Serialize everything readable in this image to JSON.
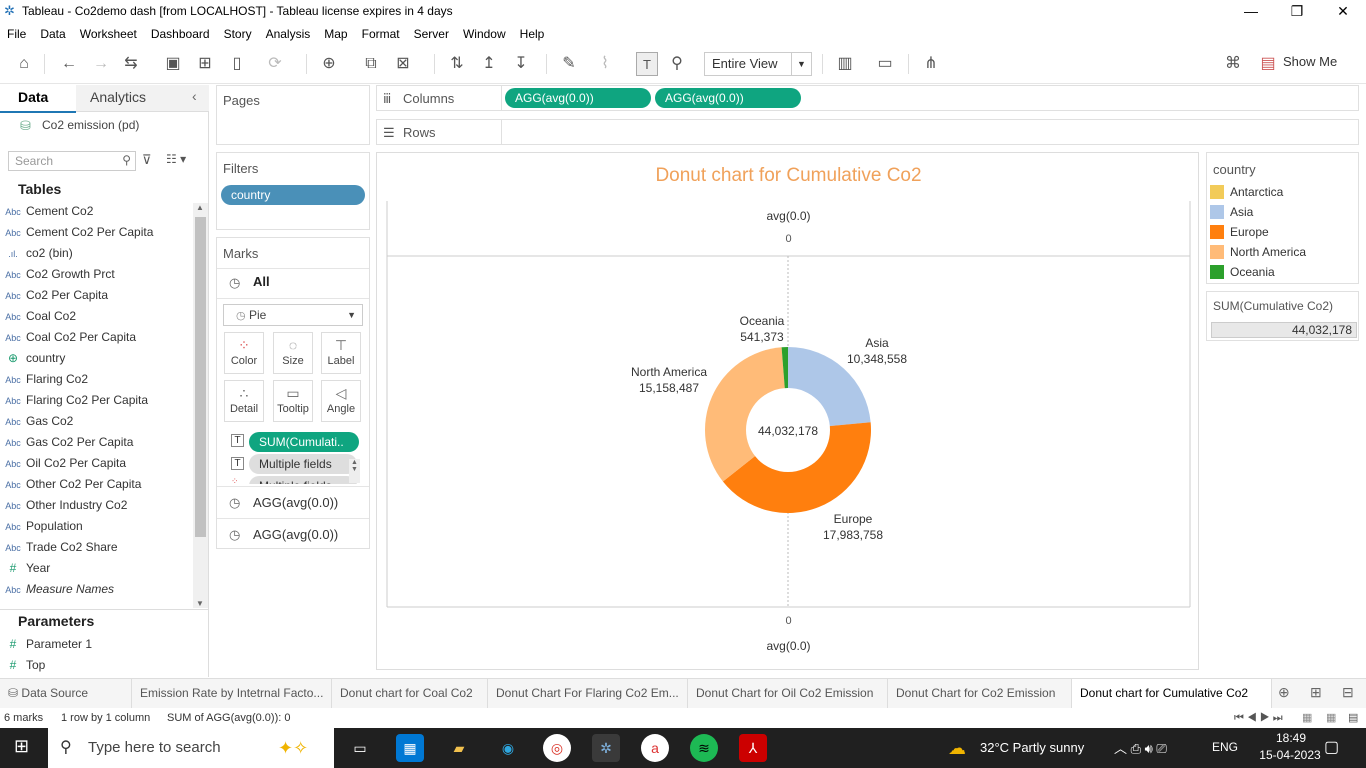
{
  "window": {
    "title": "Tableau - Co2demo dash [from LOCALHOST] - Tableau license expires in 4 days"
  },
  "menu": [
    "File",
    "Data",
    "Worksheet",
    "Dashboard",
    "Story",
    "Analysis",
    "Map",
    "Format",
    "Server",
    "Window",
    "Help"
  ],
  "toolbar": {
    "view_mode": "Entire View",
    "show_me": "Show Me"
  },
  "sidebar": {
    "tab_data": "Data",
    "tab_analytics": "Analytics",
    "datasource": "Co2 emission (pd)",
    "search_placeholder": "Search",
    "tables_heading": "Tables",
    "fields": [
      {
        "type": "Abc",
        "name": "Cement Co2"
      },
      {
        "type": "Abc",
        "name": "Cement Co2 Per Capita"
      },
      {
        "type": ".ıl.",
        "name": "co2 (bin)"
      },
      {
        "type": "Abc",
        "name": "Co2 Growth Prct"
      },
      {
        "type": "Abc",
        "name": "Co2 Per Capita"
      },
      {
        "type": "Abc",
        "name": "Coal Co2"
      },
      {
        "type": "Abc",
        "name": "Coal Co2 Per Capita"
      },
      {
        "type": "⊕",
        "name": "country"
      },
      {
        "type": "Abc",
        "name": "Flaring Co2"
      },
      {
        "type": "Abc",
        "name": "Flaring Co2 Per Capita"
      },
      {
        "type": "Abc",
        "name": "Gas Co2"
      },
      {
        "type": "Abc",
        "name": "Gas Co2 Per Capita"
      },
      {
        "type": "Abc",
        "name": "Oil Co2 Per Capita"
      },
      {
        "type": "Abc",
        "name": "Other Co2 Per Capita"
      },
      {
        "type": "Abc",
        "name": "Other Industry Co2"
      },
      {
        "type": "Abc",
        "name": "Population"
      },
      {
        "type": "Abc",
        "name": "Trade Co2 Share"
      },
      {
        "type": "#",
        "name": "Year"
      },
      {
        "type": "Abc",
        "name": "Measure Names"
      }
    ],
    "parameters_heading": "Parameters",
    "parameters": [
      {
        "type": "#",
        "name": "Parameter 1"
      },
      {
        "type": "#",
        "name": "Top"
      }
    ]
  },
  "shelves": {
    "pages": "Pages",
    "filters": "Filters",
    "filter_pill": "country",
    "marks": "Marks",
    "marks_all": "All",
    "mark_type": "Pie",
    "cards": [
      "Color",
      "Size",
      "Label",
      "Detail",
      "Tooltip",
      "Angle"
    ],
    "mark_pills": [
      "SUM(Cumulati..",
      "Multiple fields",
      "Multiple fields"
    ],
    "agg_rows": [
      "AGG(avg(0.0))",
      "AGG(avg(0.0))"
    ],
    "columns_label": "Columns",
    "columns_pills": [
      "AGG(avg(0.0))",
      "AGG(avg(0.0))"
    ],
    "rows_label": "Rows"
  },
  "chart_data": {
    "type": "pie",
    "title": "Donut chart for Cumulative Co2",
    "axis_top_label": "avg(0.0)",
    "axis_top_value": "0",
    "axis_bottom_value": "0",
    "axis_bottom_label": "avg(0.0)",
    "center_total": "44,032,178",
    "slices": [
      {
        "name": "Asia",
        "value": 10348558,
        "label": "10,348,558",
        "color": "#aec7e8"
      },
      {
        "name": "Europe",
        "value": 17983758,
        "label": "17,983,758",
        "color": "#ff7f0e"
      },
      {
        "name": "North America",
        "value": 15158487,
        "label": "15,158,487",
        "color": "#ffbb78"
      },
      {
        "name": "Oceania",
        "value": 541373,
        "label": "541,373",
        "color": "#2ca02c"
      }
    ]
  },
  "legend": {
    "title": "country",
    "items": [
      {
        "name": "Antarctica",
        "color": "#f2cb59"
      },
      {
        "name": "Asia",
        "color": "#aec7e8"
      },
      {
        "name": "Europe",
        "color": "#ff7f0e"
      },
      {
        "name": "North America",
        "color": "#ffbb78"
      },
      {
        "name": "Oceania",
        "color": "#2ca02c"
      }
    ],
    "size_title": "SUM(Cumulative Co2)",
    "size_value": "44,032,178"
  },
  "tabs": [
    "Data Source",
    "Emission Rate by Intetrnal Facto...",
    "Donut chart for Coal Co2",
    "Donut Chart For Flaring Co2  Em...",
    "Donut Chart for Oil Co2 Emission",
    "Donut Chart for Co2 Emission",
    "Donut chart for Cumulative Co2"
  ],
  "status": {
    "marks": "6 marks",
    "dims": "1 row by 1 column",
    "sum": "SUM of AGG(avg(0.0)): 0"
  },
  "taskbar": {
    "search_placeholder": "Type here to search",
    "weather": "32°C  Partly sunny",
    "lang": "ENG",
    "time": "18:49",
    "date": "15-04-2023"
  }
}
